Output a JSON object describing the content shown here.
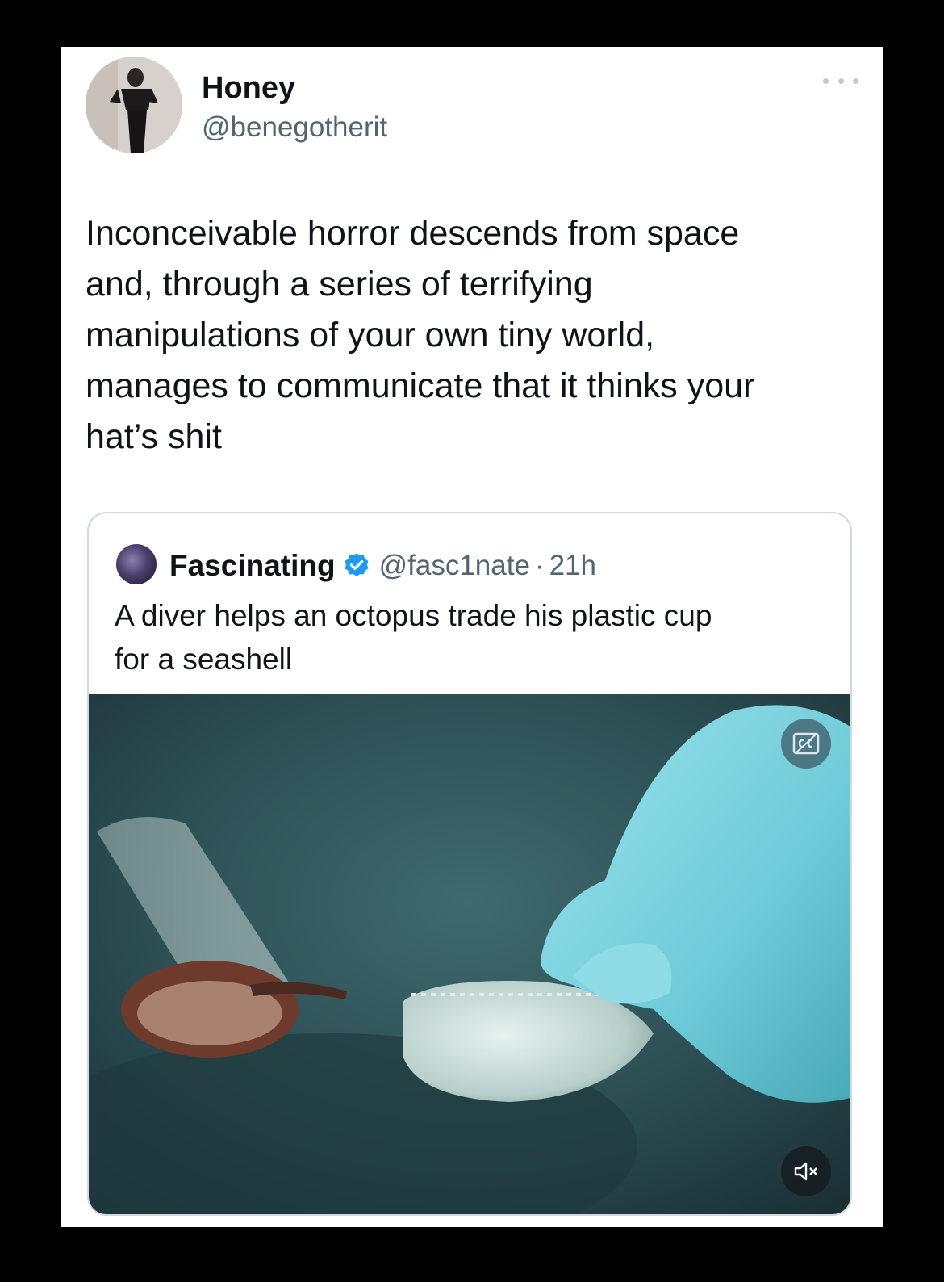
{
  "tweet": {
    "display_name": "Honey",
    "handle": "@benegotherit",
    "text": "Inconceivable horror descends from space\nand, through a series of terrifying\nmanipulations of your own tiny world,\nmanages to communicate that it thinks your\nhat’s shit"
  },
  "quoted_tweet": {
    "display_name": "Fascinating",
    "handle": "@fasc1nate",
    "separator": "·",
    "time": "21h",
    "text": "A diver helps an octopus trade his plastic cup\nfor a seashell",
    "verified": true
  },
  "icons": {
    "more": "more-horizontal-icon",
    "verified": "verified-badge-icon",
    "captions": "closed-captions-icon",
    "mute": "volume-muted-icon"
  },
  "colors": {
    "background": "#000000",
    "card": "#ffffff",
    "text_primary": "#0f1419",
    "text_secondary": "#536471",
    "verified_blue": "#1d9bf0",
    "border": "#cfd9de"
  }
}
